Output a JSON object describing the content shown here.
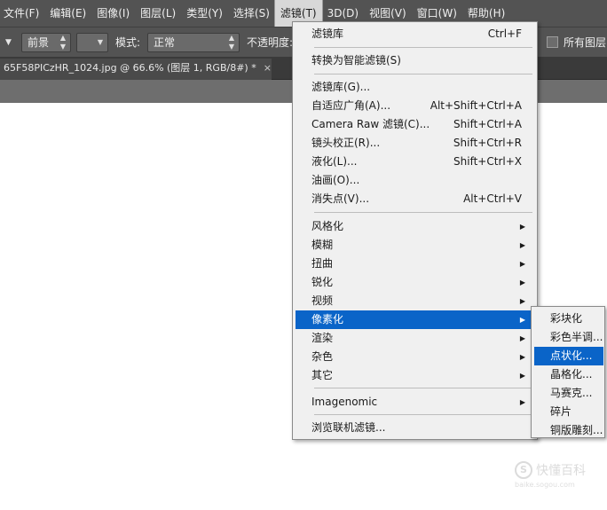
{
  "menubar": {
    "items": [
      "文件(F)",
      "编辑(E)",
      "图像(I)",
      "图层(L)",
      "类型(Y)",
      "选择(S)",
      "滤镜(T)",
      "3D(D)",
      "视图(V)",
      "窗口(W)",
      "帮助(H)"
    ],
    "active": "滤镜(T)"
  },
  "options": {
    "source_value": "前景",
    "mode_label": "模式:",
    "mode_value": "正常",
    "opacity_label": "不透明度:",
    "all_layers_label": "所有图层"
  },
  "document_tab": {
    "title": "65F58PICzHR_1024.jpg @ 66.6% (图层 1, RGB/8#) *",
    "close": "×"
  },
  "filter_menu": {
    "items": [
      {
        "label": "滤镜库",
        "shortcut": "Ctrl+F",
        "submenu": false
      },
      {
        "label": "转换为智能滤镜(S)",
        "shortcut": "",
        "submenu": false
      },
      {
        "label": "滤镜库(G)...",
        "shortcut": "",
        "submenu": false
      },
      {
        "label": "自适应广角(A)...",
        "shortcut": "Alt+Shift+Ctrl+A",
        "submenu": false
      },
      {
        "label": "Camera Raw 滤镜(C)...",
        "shortcut": "Shift+Ctrl+A",
        "submenu": false
      },
      {
        "label": "镜头校正(R)...",
        "shortcut": "Shift+Ctrl+R",
        "submenu": false
      },
      {
        "label": "液化(L)...",
        "shortcut": "Shift+Ctrl+X",
        "submenu": false
      },
      {
        "label": "油画(O)...",
        "shortcut": "",
        "submenu": false
      },
      {
        "label": "消失点(V)...",
        "shortcut": "Alt+Ctrl+V",
        "submenu": false
      },
      {
        "label": "风格化",
        "shortcut": "",
        "submenu": true
      },
      {
        "label": "模糊",
        "shortcut": "",
        "submenu": true
      },
      {
        "label": "扭曲",
        "shortcut": "",
        "submenu": true
      },
      {
        "label": "锐化",
        "shortcut": "",
        "submenu": true
      },
      {
        "label": "视频",
        "shortcut": "",
        "submenu": true
      },
      {
        "label": "像素化",
        "shortcut": "",
        "submenu": true,
        "highlighted": true
      },
      {
        "label": "渲染",
        "shortcut": "",
        "submenu": true
      },
      {
        "label": "杂色",
        "shortcut": "",
        "submenu": true
      },
      {
        "label": "其它",
        "shortcut": "",
        "submenu": true
      },
      {
        "label": "Imagenomic",
        "shortcut": "",
        "submenu": true
      },
      {
        "label": "浏览联机滤镜...",
        "shortcut": "",
        "submenu": false
      }
    ]
  },
  "pixelate_submenu": {
    "items": [
      {
        "label": "彩块化"
      },
      {
        "label": "彩色半调..."
      },
      {
        "label": "点状化...",
        "highlighted": true
      },
      {
        "label": "晶格化..."
      },
      {
        "label": "马赛克..."
      },
      {
        "label": "碎片"
      },
      {
        "label": "铜版雕刻..."
      }
    ]
  },
  "watermark": {
    "icon_text": "S",
    "text": "快懂百科",
    "sub": "baike.sogou.com"
  },
  "colors": {
    "menubar_bg": "#535353",
    "highlight": "#0a64c8",
    "menu_bg": "#f0f0f0"
  }
}
